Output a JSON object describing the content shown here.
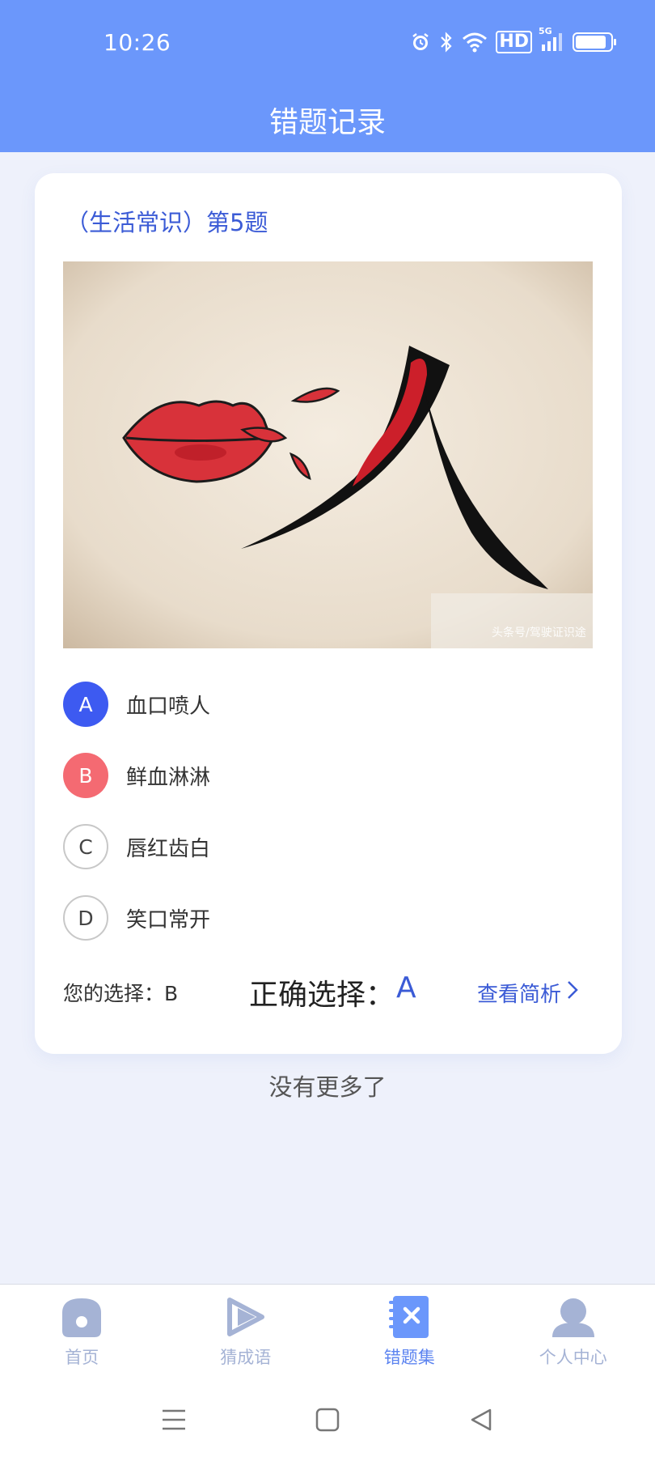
{
  "status_bar": {
    "time": "10:26",
    "network": "5G",
    "hd_label": "HD",
    "icons": [
      "alarm-icon",
      "bluetooth-icon",
      "wifi-icon",
      "hd-icon",
      "signal-icon",
      "battery-icon"
    ]
  },
  "header": {
    "title": "错题记录"
  },
  "question": {
    "title": "（生活常识）第5题",
    "image_watermark": "头条号/驾驶证识途"
  },
  "options": [
    {
      "letter": "A",
      "text": "血口喷人",
      "state": "correct"
    },
    {
      "letter": "B",
      "text": "鲜血淋淋",
      "state": "wrong"
    },
    {
      "letter": "C",
      "text": "唇红齿白",
      "state": "plain"
    },
    {
      "letter": "D",
      "text": "笑口常开",
      "state": "plain"
    }
  ],
  "answer": {
    "your_choice_label": "您的选择：B",
    "correct_label": "正确选择：",
    "correct_value": "A",
    "analysis_link": "查看简析"
  },
  "footer": {
    "no_more": "没有更多了"
  },
  "tabs": [
    {
      "label": "首页",
      "icon": "home-icon",
      "active": false
    },
    {
      "label": "猜成语",
      "icon": "play-icon",
      "active": false
    },
    {
      "label": "错题集",
      "icon": "wrong-book-icon",
      "active": true
    },
    {
      "label": "个人中心",
      "icon": "user-icon",
      "active": false
    }
  ],
  "colors": {
    "header": "#6b97fb",
    "accent": "#3b5bd6",
    "correct": "#3d5af1",
    "wrong": "#f46a72",
    "background": "#eef1fb",
    "tab_inactive": "#a5b3d5",
    "tab_active": "#5b83f0"
  }
}
